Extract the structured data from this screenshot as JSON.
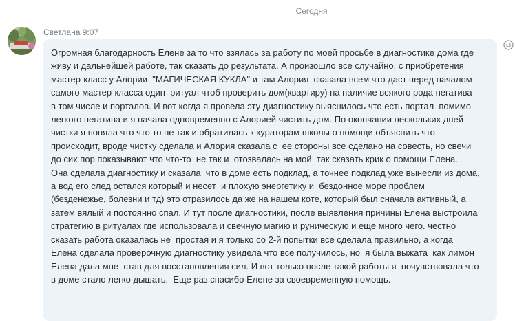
{
  "divider": {
    "label": "Сегодня"
  },
  "message": {
    "sender": "Светлана",
    "time": "9:07",
    "header": "Светлана 9:07",
    "text": "Огромная благодарность Елене за то что взялась за работу по моей просьбе в диагностике дома где\nживу и дальнейшей работе, так сказать до результата. А произошло все случайно, с приобретения\nмастер-класс у Алории  \"МАГИЧЕСКАЯ КУКЛА\" и там Алория  сказала всем что даст перед началом\nсамого мастер-класса один  ритуал чтоб проверить дом(квартиру) на наличие всякого рода негатива\nв том числе и порталов. И вот когда я провела эту диагностику выяснилось что есть портал  помимо\nлегкого негатива и я начала одновременно с Алорией чистить дом. По окончании нескольких дней\nчистки я поняла что что то не так и обратилась к кураторам школы о помощи объяснить что\nпроисходит, вроде чистку сделала и Алория сказала с  ее стороны все сделано на совесть, но свечи\nдо сих пор показывают что что-то  не так и  отозвалась на мой  так сказать крик о помощи Елена.\nОна сделала диагностику и сказала  что в доме есть подклад, а точнее подклад уже вынесли из дома,\nа вод его след остался который и несет  и плохую энергетику и  бездонное море проблем\n(безденежье, болезни и тд) это отразилось да же на нашем коте, который был сначала активный, а\nзатем вялый и постоянно спал. И тут после диагностики, после выявления причины Елена выстроила\nстратегию в ритуалах где использовала и свечную магию и руническую и еще много чего. честно\nсказать работа оказалась не  простая и я только со 2-й попытки все сделала правильно, а когда\nЕлена сделала проверочную диагностику увидела что все получилось, но  я была выжата  как лимон\nЕлена дала мне  став для восстановления сил. И вот только после такой работы я  почувствовала что\nв доме стало легко дышать.  Еще раз спасибо Елене за своевременную помощь."
  },
  "icons": {
    "avatar": "avatar-photo",
    "reaction": "smile-icon"
  },
  "colors": {
    "bubble_background": "#eef3f8",
    "text": "#2c2d2e",
    "meta_text": "#707b86",
    "divider_line": "#e3e6ea"
  }
}
